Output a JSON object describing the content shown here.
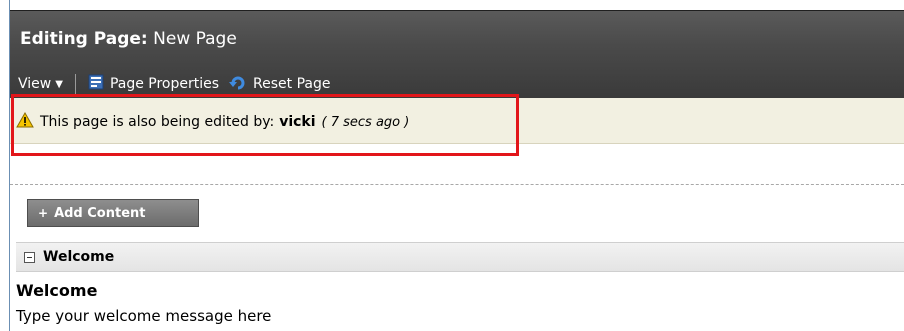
{
  "header": {
    "title_prefix": "Editing Page:",
    "title_page": "New Page"
  },
  "toolbar": {
    "view_label": "View",
    "page_properties_label": "Page Properties",
    "reset_page_label": "Reset Page"
  },
  "warning": {
    "message": "This page is also being edited by:",
    "user": "vicki",
    "time_ago": "( 7 secs ago )"
  },
  "content": {
    "add_content_label": "Add Content",
    "portlet_title": "Welcome",
    "welcome_heading": "Welcome",
    "welcome_message": "Type your welcome message here"
  },
  "colors": {
    "highlight": "#e2161a",
    "warning_bg": "#f2f0e1",
    "header_bg": "#4a4a4a"
  },
  "icons": [
    "chevron-down-icon",
    "page-properties-icon",
    "reset-icon",
    "warning-icon",
    "plus-icon",
    "collapse-icon"
  ]
}
